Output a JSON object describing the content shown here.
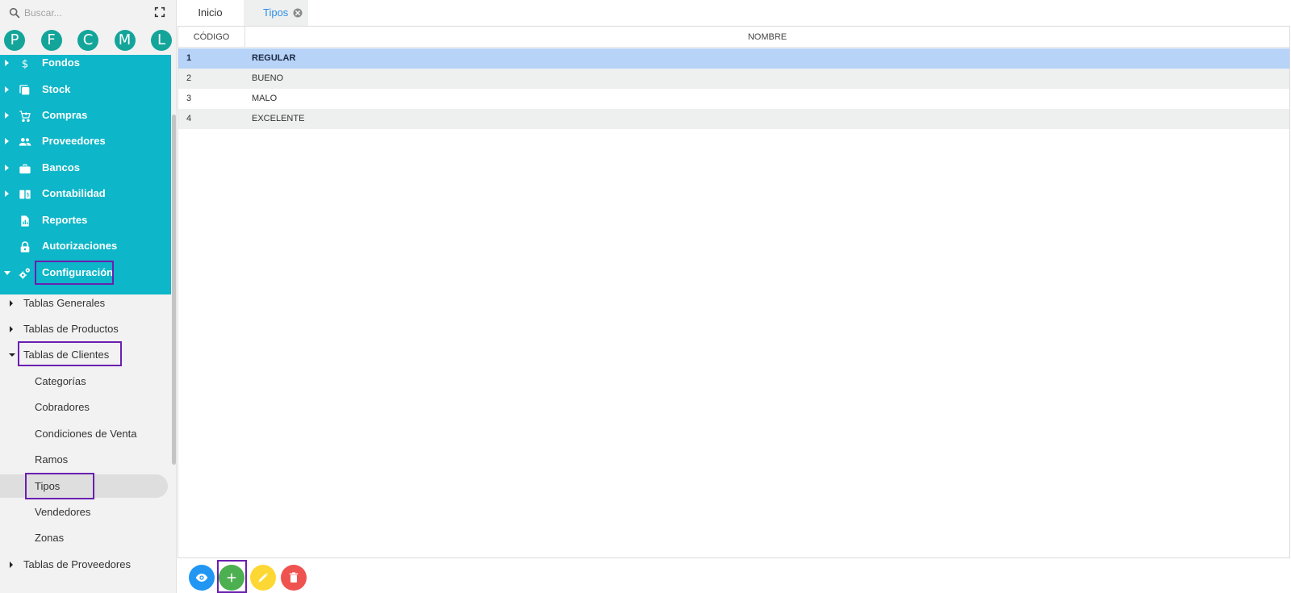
{
  "search": {
    "placeholder": "Buscar..."
  },
  "quick_access": [
    "P",
    "F",
    "C",
    "M",
    "L"
  ],
  "menu": [
    {
      "label": "Fondos",
      "icon": "dollar-icon",
      "expandable": true
    },
    {
      "label": "Stock",
      "icon": "stock-icon",
      "expandable": true
    },
    {
      "label": "Compras",
      "icon": "cart-icon",
      "expandable": true
    },
    {
      "label": "Proveedores",
      "icon": "people-icon",
      "expandable": true
    },
    {
      "label": "Bancos",
      "icon": "briefcase-icon",
      "expandable": true
    },
    {
      "label": "Contabilidad",
      "icon": "ledger-icon",
      "expandable": true
    },
    {
      "label": "Reportes",
      "icon": "report-icon",
      "expandable": false
    },
    {
      "label": "Autorizaciones",
      "icon": "lock-icon",
      "expandable": false
    },
    {
      "label": "Configuración",
      "icon": "gears-icon",
      "expandable": true,
      "expanded": true
    }
  ],
  "submenu": [
    {
      "label": "Tablas Generales"
    },
    {
      "label": "Tablas de Productos"
    },
    {
      "label": "Tablas de Clientes",
      "expanded": true
    },
    {
      "label": "Categorías"
    },
    {
      "label": "Cobradores"
    },
    {
      "label": "Condiciones de Venta"
    },
    {
      "label": "Ramos"
    },
    {
      "label": "Tipos",
      "active": true
    },
    {
      "label": "Vendedores"
    },
    {
      "label": "Zonas"
    },
    {
      "label": "Tablas de Proveedores"
    }
  ],
  "tabs": [
    {
      "label": "Inicio"
    },
    {
      "label": "Tipos",
      "active": true
    }
  ],
  "grid": {
    "columns": [
      "CÓDIGO",
      "NOMBRE"
    ],
    "rows": [
      {
        "codigo": "1",
        "nombre": "REGULAR",
        "selected": true
      },
      {
        "codigo": "2",
        "nombre": "BUENO"
      },
      {
        "codigo": "3",
        "nombre": "MALO"
      },
      {
        "codigo": "4",
        "nombre": "EXCELENTE"
      }
    ]
  },
  "actions": [
    {
      "name": "view",
      "icon": "eye-icon",
      "color": "#2196f3"
    },
    {
      "name": "add",
      "icon": "plus-icon",
      "color": "#4caf50"
    },
    {
      "name": "edit",
      "icon": "pencil-icon",
      "color": "#fdd835"
    },
    {
      "name": "delete",
      "icon": "trash-icon",
      "color": "#ef5350"
    }
  ],
  "colors": {
    "menu_bg": "#0db6c8",
    "quick_btn": "#13a59a",
    "highlight": "#6a1fb0",
    "tab_active_text": "#2f8de4",
    "row_selected": "#b7d3f7"
  }
}
